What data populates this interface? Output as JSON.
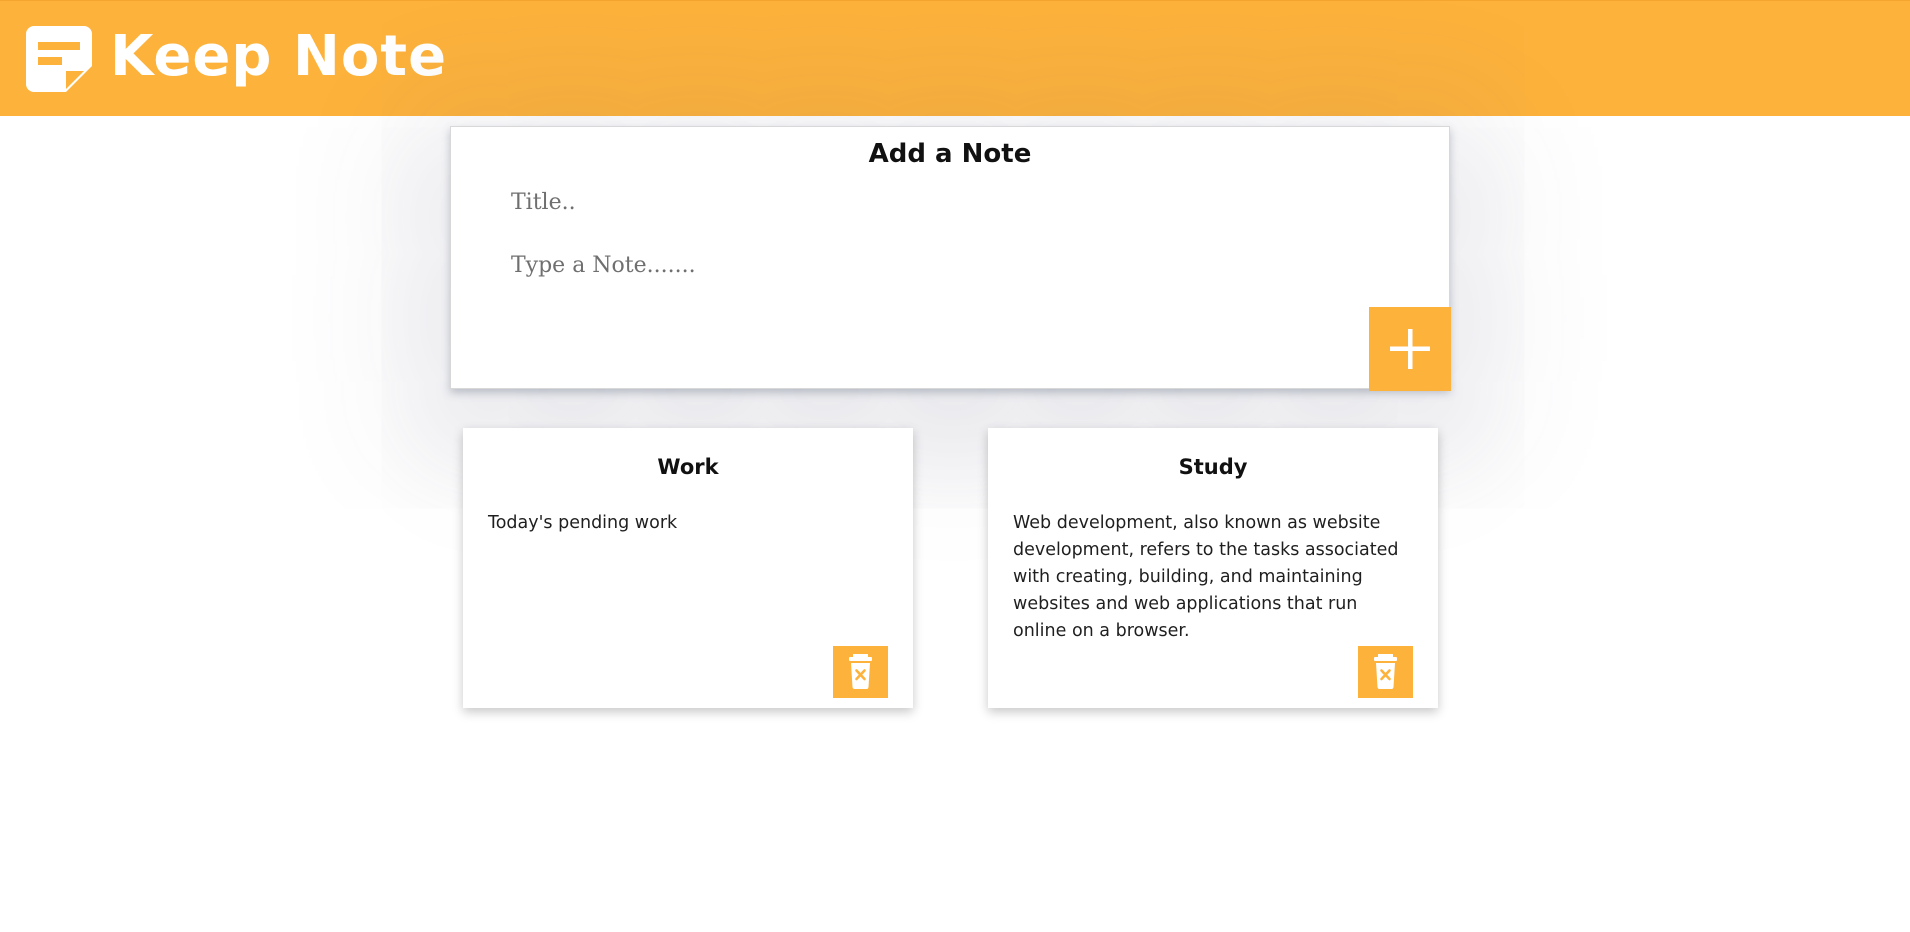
{
  "header": {
    "app_title": "Keep Note",
    "logo_icon": "sticky-note-icon",
    "background_color": "#fdb23c"
  },
  "add_note": {
    "heading": "Add a Note",
    "title_placeholder": "Title..",
    "title_value": "",
    "note_placeholder": "Type a Note.......",
    "note_value": "",
    "add_button_icon": "plus-icon"
  },
  "notes": [
    {
      "title": "Work",
      "content": "Today's pending work",
      "delete_icon": "trash-icon"
    },
    {
      "title": "Study",
      "content": "Web development, also known as website development, refers to the tasks associated with creating, building, and maintaining websites and web applications that run online on a browser.",
      "delete_icon": "trash-icon"
    }
  ],
  "colors": {
    "accent": "#fdb23c",
    "text": "#111111"
  }
}
